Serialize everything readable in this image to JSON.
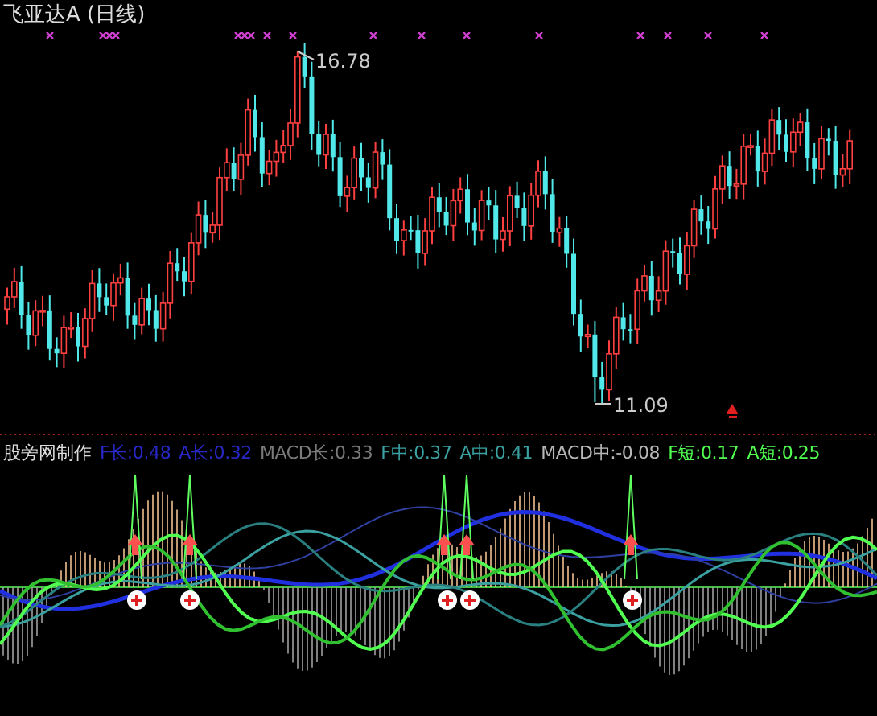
{
  "title": "飞亚达A (日线)",
  "price_chart": {
    "high_label": "16.78",
    "low_label": "11.09"
  },
  "indicator": {
    "source": "股旁网制作",
    "legend": [
      {
        "text": "F长:0.48",
        "color": "#2828c8"
      },
      {
        "text": "A长:0.32",
        "color": "#2828c8"
      },
      {
        "text": "MACD长:0.33",
        "color": "#7a7a7a"
      },
      {
        "text": "F中:0.37",
        "color": "#3aa0a0"
      },
      {
        "text": "A中:0.41",
        "color": "#3aa0a0"
      },
      {
        "text": "MACD中:-0.08",
        "color": "#b8b8b8"
      },
      {
        "text": "F短:0.17",
        "color": "#50ff50"
      },
      {
        "text": "A短:0.25",
        "color": "#50ff50"
      }
    ]
  }
}
